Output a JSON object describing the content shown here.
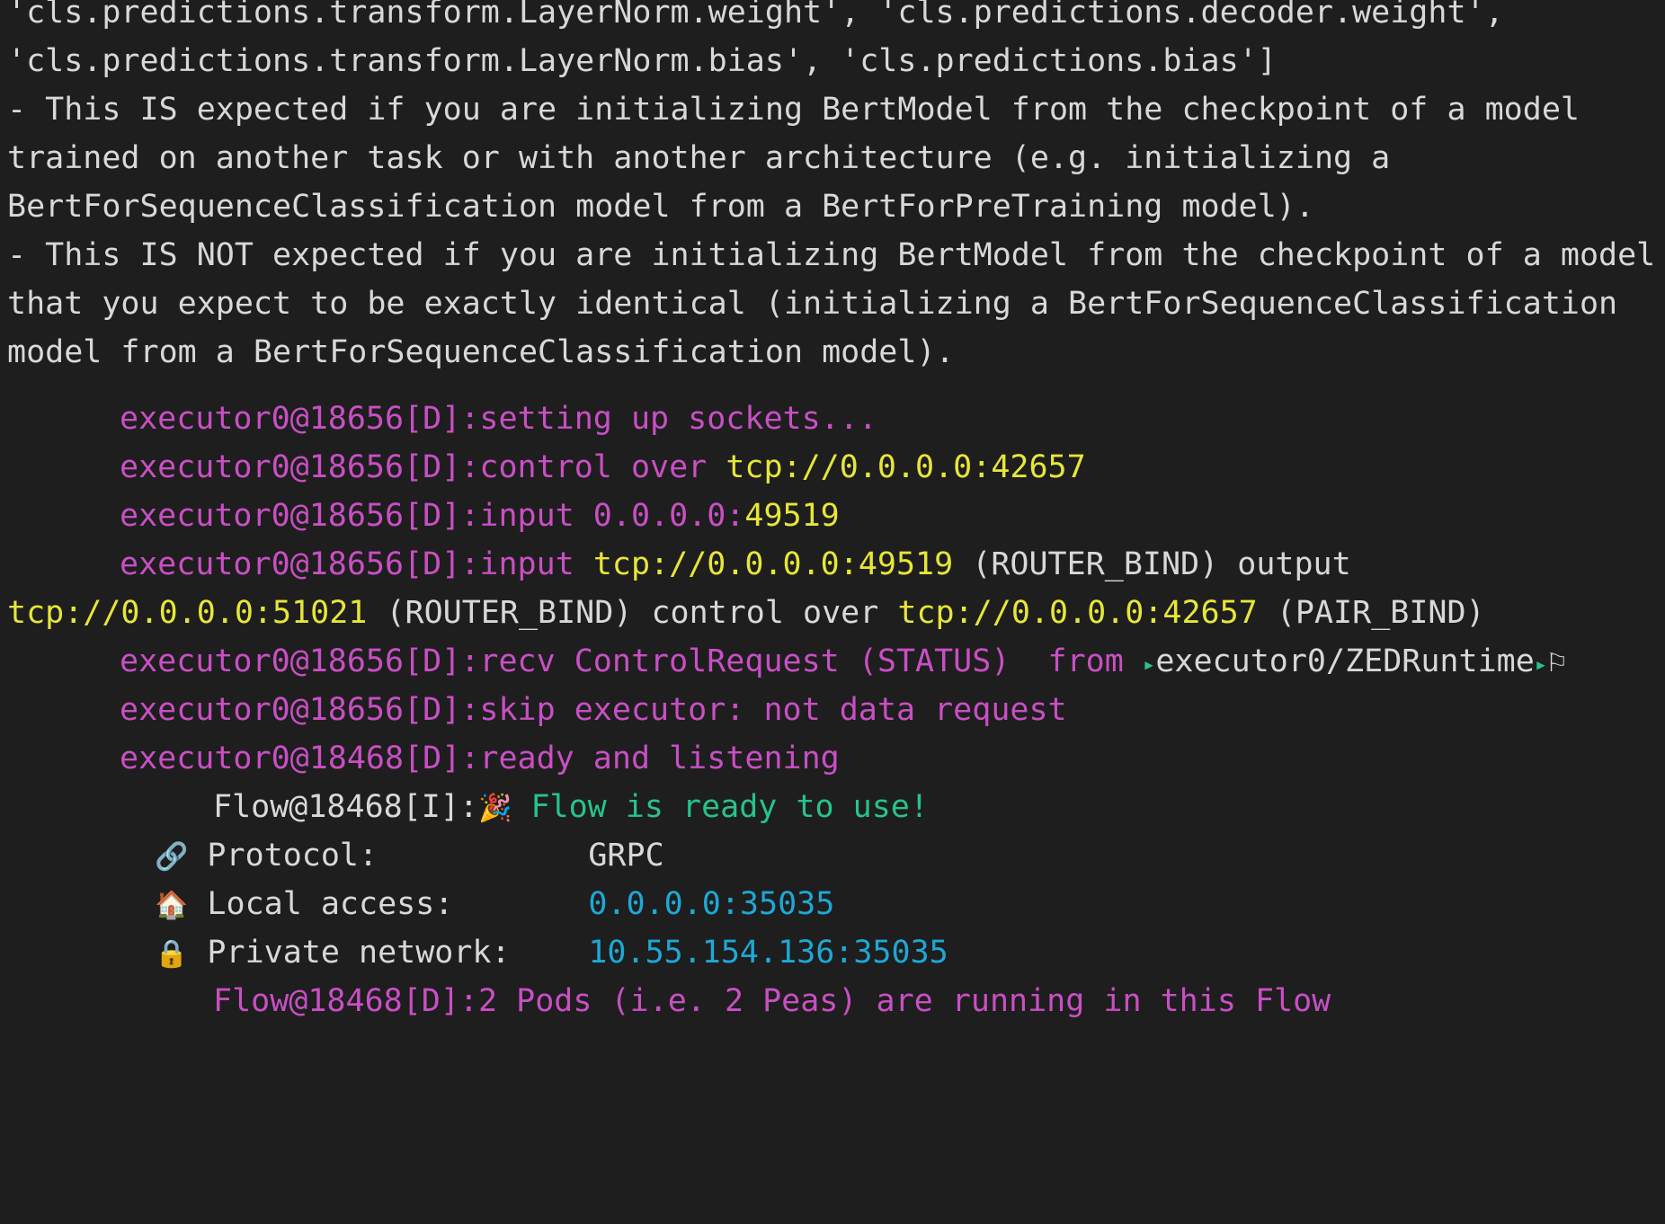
{
  "colors": {
    "background": "#1e1e1e",
    "text": "#d8d8d8",
    "debug_log": "#c94fc4",
    "address": "#e6e63a",
    "success": "#27c38a",
    "network": "#1ea8d6"
  },
  "warning_lines": [
    "'cls.predictions.transform.LayerNorm.weight', 'cls.predictions.decoder.weight',",
    "'cls.predictions.transform.LayerNorm.bias', 'cls.predictions.bias']",
    "- This IS expected if you are initializing BertModel from the checkpoint of a model",
    "trained on another task or with another architecture (e.g. initializing a",
    "BertForSequenceClassification model from a BertForPreTraining model).",
    "- This IS NOT expected if you are initializing BertModel from the checkpoint of a model",
    "that you expect to be exactly identical (initializing a BertForSequenceClassification",
    "model from a BertForSequenceClassification model)."
  ],
  "log": {
    "l1": {
      "prefix": "executor0@18656[D]:",
      "msg": "setting up sockets..."
    },
    "l2": {
      "prefix": "executor0@18656[D]:",
      "msg": "control over ",
      "addr": "tcp://0.0.0.0:42657"
    },
    "l3": {
      "prefix": "executor0@18656[D]:",
      "msg": "input 0.0.0.0:",
      "port": "49519"
    },
    "l4": {
      "prefix": "executor0@18656[D]:",
      "msg": "input ",
      "addr": "tcp://0.0.0.0:49519",
      "rest": " (ROUTER_BIND) output"
    },
    "l5": {
      "addr1": "tcp://0.0.0.0:51021",
      "mid": " (ROUTER_BIND) control over ",
      "addr2": "tcp://0.0.0.0:42657",
      "tail": " (PAIR_BIND)"
    },
    "l6": {
      "prefix": "executor0@18656[D]:",
      "msg": "recv ControlRequest (STATUS)  from ",
      "tri": "▸",
      "route": "executor0/ZEDRuntime",
      "tri_end": "▸",
      "flag": "⚐"
    },
    "l7": {
      "prefix": "executor0@18656[D]:",
      "msg": "skip executor: not data request"
    },
    "l8": {
      "prefix": "executor0@18468[D]:",
      "msg": "ready and listening"
    },
    "l9": {
      "prefix": "Flow@18468[I]:",
      "emoji": "🎉",
      "msg": " Flow is ready to use!"
    },
    "l10": {
      "emoji": "🔗",
      "label": " Protocol:",
      "value": "GRPC"
    },
    "l11": {
      "emoji": "🏠",
      "label": " Local access:",
      "value": "0.0.0.0:35035"
    },
    "l12": {
      "emoji": "🔒",
      "label": " Private network:",
      "value": "10.55.154.136:35035"
    },
    "l13": {
      "prefix": "Flow@18468[D]:",
      "msg": "2 Pods (i.e. 2 Peas) are running in this Flow"
    }
  }
}
